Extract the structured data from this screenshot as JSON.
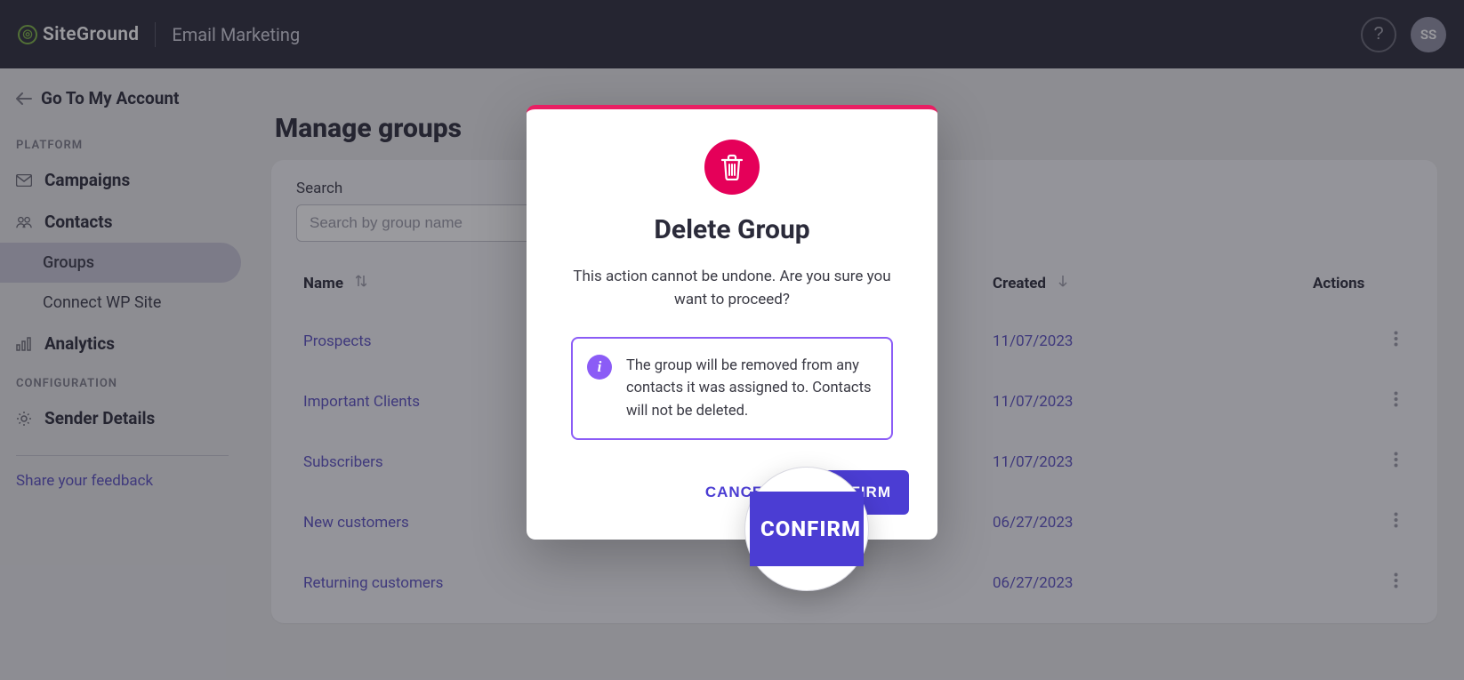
{
  "header": {
    "logo_text": "SiteGround",
    "app_name": "Email Marketing",
    "help_label": "?",
    "avatar_initials": "SS"
  },
  "sidebar": {
    "go_back": "Go To My Account",
    "platform_label": "PLATFORM",
    "configuration_label": "CONFIGURATION",
    "items": {
      "campaigns": "Campaigns",
      "contacts": "Contacts",
      "groups": "Groups",
      "connect_wp": "Connect WP Site",
      "analytics": "Analytics",
      "sender_details": "Sender Details"
    },
    "feedback": "Share your feedback"
  },
  "page": {
    "title": "Manage groups",
    "search_label": "Search",
    "search_placeholder": "Search by group name",
    "columns": {
      "name": "Name",
      "created": "Created",
      "actions": "Actions"
    },
    "rows": [
      {
        "name": "Prospects",
        "created": "11/07/2023"
      },
      {
        "name": "Important Clients",
        "created": "11/07/2023"
      },
      {
        "name": "Subscribers",
        "created": "11/07/2023"
      },
      {
        "name": "New customers",
        "created": "06/27/2023"
      },
      {
        "name": "Returning customers",
        "created": "06/27/2023"
      }
    ]
  },
  "modal": {
    "title": "Delete Group",
    "message": "This action cannot be undone. Are you sure you want to proceed?",
    "info": "The group will be removed from any contacts it was assigned to. Contacts will not be deleted.",
    "cancel": "CANCEL",
    "confirm": "CONFIRM"
  }
}
